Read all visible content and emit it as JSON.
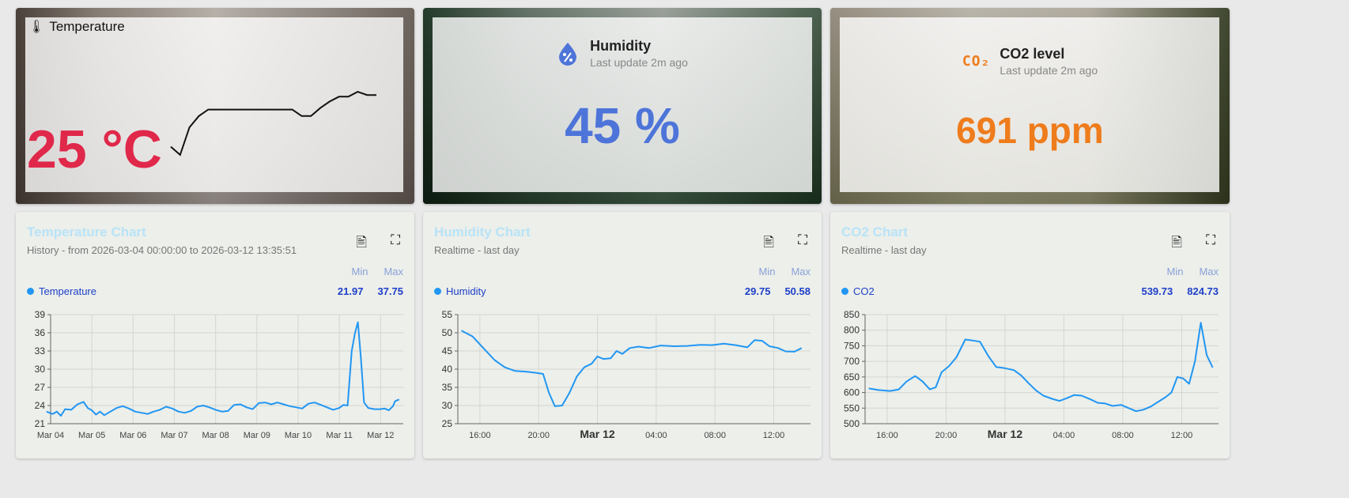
{
  "temperature_card": {
    "icon": "thermometer-icon",
    "title": "Temperature",
    "value": "25 °C",
    "sparkline": [
      22.3,
      21.8,
      23.5,
      24.2,
      24.6,
      24.6,
      24.6,
      24.6,
      24.6,
      24.6,
      24.6,
      24.6,
      24.6,
      24.6,
      24.2,
      24.2,
      24.7,
      25.1,
      25.4,
      25.4,
      25.7,
      25.5,
      25.5
    ]
  },
  "humidity_card": {
    "icon": "humidity-drop-icon",
    "title": "Humidity",
    "subtitle": "Last update 2m ago",
    "value": "45 %"
  },
  "co2_card": {
    "icon": "co2-icon",
    "icon_text": "CO₂",
    "title": "CO2 level",
    "subtitle": "Last update 2m ago",
    "value": "691 ppm"
  },
  "colors": {
    "temperature": "#e0284a",
    "humidity": "#4d74d9",
    "co2": "#ef7c1c",
    "series": "#2196f3",
    "chart_title": "#b9e3f7"
  },
  "temperature_chart": {
    "title": "Temperature Chart",
    "subtitle": "History - from 2026-03-04 00:00:00 to 2026-03-12 13:35:51",
    "min_label": "Min",
    "max_label": "Max",
    "series_name": "Temperature",
    "min": "21.97",
    "max": "37.75"
  },
  "humidity_chart": {
    "title": "Humidity Chart",
    "subtitle": "Realtime - last day",
    "min_label": "Min",
    "max_label": "Max",
    "series_name": "Humidity",
    "min": "29.75",
    "max": "50.58"
  },
  "co2_chart": {
    "title": "CO2 Chart",
    "subtitle": "Realtime - last day",
    "min_label": "Min",
    "max_label": "Max",
    "series_name": "CO2",
    "min": "539.73",
    "max": "824.73"
  },
  "chart_data": [
    {
      "type": "line",
      "ylim": [
        21,
        39
      ],
      "yticks": [
        21,
        24,
        27,
        30,
        33,
        36,
        39
      ],
      "xlim": [
        0,
        8.55
      ],
      "xticks": [
        {
          "x": 0,
          "label": "Mar 04"
        },
        {
          "x": 1,
          "label": "Mar 05"
        },
        {
          "x": 2,
          "label": "Mar 06"
        },
        {
          "x": 3,
          "label": "Mar 07"
        },
        {
          "x": 4,
          "label": "Mar 08"
        },
        {
          "x": 5,
          "label": "Mar 09"
        },
        {
          "x": 6,
          "label": "Mar 10"
        },
        {
          "x": 7,
          "label": "Mar 11"
        },
        {
          "x": 8,
          "label": "Mar 12"
        }
      ],
      "series": [
        {
          "name": "Temperature",
          "points": [
            [
              -0.1,
              23.0
            ],
            [
              0.05,
              22.6
            ],
            [
              0.15,
              23.0
            ],
            [
              0.25,
              22.3
            ],
            [
              0.35,
              23.4
            ],
            [
              0.5,
              23.3
            ],
            [
              0.65,
              24.2
            ],
            [
              0.8,
              24.6
            ],
            [
              0.9,
              23.6
            ],
            [
              1.0,
              23.2
            ],
            [
              1.1,
              22.5
            ],
            [
              1.2,
              23.0
            ],
            [
              1.3,
              22.4
            ],
            [
              1.45,
              23.0
            ],
            [
              1.6,
              23.6
            ],
            [
              1.75,
              23.9
            ],
            [
              1.9,
              23.5
            ],
            [
              2.05,
              23.0
            ],
            [
              2.2,
              22.8
            ],
            [
              2.35,
              22.6
            ],
            [
              2.5,
              23.0
            ],
            [
              2.65,
              23.3
            ],
            [
              2.8,
              23.8
            ],
            [
              2.95,
              23.5
            ],
            [
              3.1,
              23.0
            ],
            [
              3.25,
              22.8
            ],
            [
              3.4,
              23.1
            ],
            [
              3.55,
              23.8
            ],
            [
              3.7,
              24.0
            ],
            [
              3.85,
              23.7
            ],
            [
              4.0,
              23.3
            ],
            [
              4.15,
              23.0
            ],
            [
              4.3,
              23.1
            ],
            [
              4.45,
              24.1
            ],
            [
              4.6,
              24.2
            ],
            [
              4.75,
              23.7
            ],
            [
              4.9,
              23.4
            ],
            [
              5.05,
              24.4
            ],
            [
              5.2,
              24.5
            ],
            [
              5.35,
              24.2
            ],
            [
              5.5,
              24.5
            ],
            [
              5.65,
              24.2
            ],
            [
              5.8,
              23.9
            ],
            [
              5.95,
              23.7
            ],
            [
              6.1,
              23.5
            ],
            [
              6.25,
              24.3
            ],
            [
              6.4,
              24.5
            ],
            [
              6.55,
              24.1
            ],
            [
              6.7,
              23.7
            ],
            [
              6.85,
              23.3
            ],
            [
              7.0,
              23.6
            ],
            [
              7.1,
              24.1
            ],
            [
              7.2,
              24.0
            ],
            [
              7.3,
              33.0
            ],
            [
              7.38,
              36.0
            ],
            [
              7.45,
              37.75
            ],
            [
              7.52,
              32.0
            ],
            [
              7.6,
              24.5
            ],
            [
              7.7,
              23.6
            ],
            [
              7.85,
              23.4
            ],
            [
              8.0,
              23.4
            ],
            [
              8.1,
              23.5
            ],
            [
              8.2,
              23.2
            ],
            [
              8.3,
              23.9
            ],
            [
              8.35,
              24.7
            ],
            [
              8.45,
              25.0
            ]
          ]
        }
      ]
    },
    {
      "type": "line",
      "ylim": [
        25,
        55
      ],
      "yticks": [
        25,
        30,
        35,
        40,
        45,
        50,
        55
      ],
      "xlim": [
        14.5,
        38.5
      ],
      "xticks": [
        {
          "x": 16,
          "label": "16:00"
        },
        {
          "x": 20,
          "label": "20:00"
        },
        {
          "x": 24,
          "label": "Mar 12",
          "bold": true
        },
        {
          "x": 28,
          "label": "04:00"
        },
        {
          "x": 32,
          "label": "08:00"
        },
        {
          "x": 36,
          "label": "12:00"
        }
      ],
      "series": [
        {
          "name": "Humidity",
          "points": [
            [
              14.75,
              50.6
            ],
            [
              15.5,
              49.0
            ],
            [
              16.3,
              45.5
            ],
            [
              17.0,
              42.5
            ],
            [
              17.7,
              40.5
            ],
            [
              18.4,
              39.5
            ],
            [
              19.2,
              39.3
            ],
            [
              19.8,
              39.0
            ],
            [
              20.3,
              38.7
            ],
            [
              20.7,
              33.5
            ],
            [
              21.1,
              29.8
            ],
            [
              21.6,
              30.0
            ],
            [
              22.1,
              33.5
            ],
            [
              22.6,
              38.0
            ],
            [
              23.1,
              40.5
            ],
            [
              23.6,
              41.5
            ],
            [
              24.0,
              43.5
            ],
            [
              24.4,
              42.8
            ],
            [
              24.9,
              43.0
            ],
            [
              25.3,
              45.0
            ],
            [
              25.7,
              44.2
            ],
            [
              26.2,
              45.8
            ],
            [
              26.8,
              46.2
            ],
            [
              27.5,
              45.8
            ],
            [
              28.3,
              46.5
            ],
            [
              29.2,
              46.3
            ],
            [
              30.1,
              46.4
            ],
            [
              31.0,
              46.7
            ],
            [
              31.8,
              46.6
            ],
            [
              32.6,
              47.0
            ],
            [
              33.4,
              46.6
            ],
            [
              34.2,
              46.0
            ],
            [
              34.7,
              48.0
            ],
            [
              35.2,
              47.8
            ],
            [
              35.7,
              46.3
            ],
            [
              36.3,
              45.8
            ],
            [
              36.8,
              44.9
            ],
            [
              37.4,
              44.8
            ],
            [
              37.9,
              45.8
            ]
          ]
        }
      ]
    },
    {
      "type": "line",
      "ylim": [
        500,
        850
      ],
      "yticks": [
        500,
        550,
        600,
        650,
        700,
        750,
        800,
        850
      ],
      "xlim": [
        14.5,
        38.5
      ],
      "xticks": [
        {
          "x": 16,
          "label": "16:00"
        },
        {
          "x": 20,
          "label": "20:00"
        },
        {
          "x": 24,
          "label": "Mar 12",
          "bold": true
        },
        {
          "x": 28,
          "label": "04:00"
        },
        {
          "x": 32,
          "label": "08:00"
        },
        {
          "x": 36,
          "label": "12:00"
        }
      ],
      "series": [
        {
          "name": "CO2",
          "points": [
            [
              14.75,
              613
            ],
            [
              15.4,
              608
            ],
            [
              16.2,
              605
            ],
            [
              16.8,
              610
            ],
            [
              17.3,
              635
            ],
            [
              17.9,
              653
            ],
            [
              18.4,
              636
            ],
            [
              18.9,
              610
            ],
            [
              19.3,
              617
            ],
            [
              19.7,
              665
            ],
            [
              20.2,
              685
            ],
            [
              20.7,
              713
            ],
            [
              21.3,
              770
            ],
            [
              21.8,
              767
            ],
            [
              22.3,
              763
            ],
            [
              22.9,
              715
            ],
            [
              23.4,
              682
            ],
            [
              24.0,
              678
            ],
            [
              24.6,
              672
            ],
            [
              25.1,
              655
            ],
            [
              25.6,
              630
            ],
            [
              26.1,
              607
            ],
            [
              26.6,
              590
            ],
            [
              27.2,
              580
            ],
            [
              27.7,
              573
            ],
            [
              28.2,
              582
            ],
            [
              28.7,
              592
            ],
            [
              29.2,
              590
            ],
            [
              29.8,
              578
            ],
            [
              30.3,
              567
            ],
            [
              30.8,
              565
            ],
            [
              31.3,
              557
            ],
            [
              31.9,
              560
            ],
            [
              32.4,
              550
            ],
            [
              32.9,
              540
            ],
            [
              33.4,
              545
            ],
            [
              33.9,
              555
            ],
            [
              34.4,
              570
            ],
            [
              34.9,
              585
            ],
            [
              35.3,
              600
            ],
            [
              35.7,
              650
            ],
            [
              36.1,
              645
            ],
            [
              36.5,
              628
            ],
            [
              36.9,
              700
            ],
            [
              37.3,
              824
            ],
            [
              37.7,
              720
            ],
            [
              38.1,
              680
            ]
          ]
        }
      ]
    }
  ]
}
